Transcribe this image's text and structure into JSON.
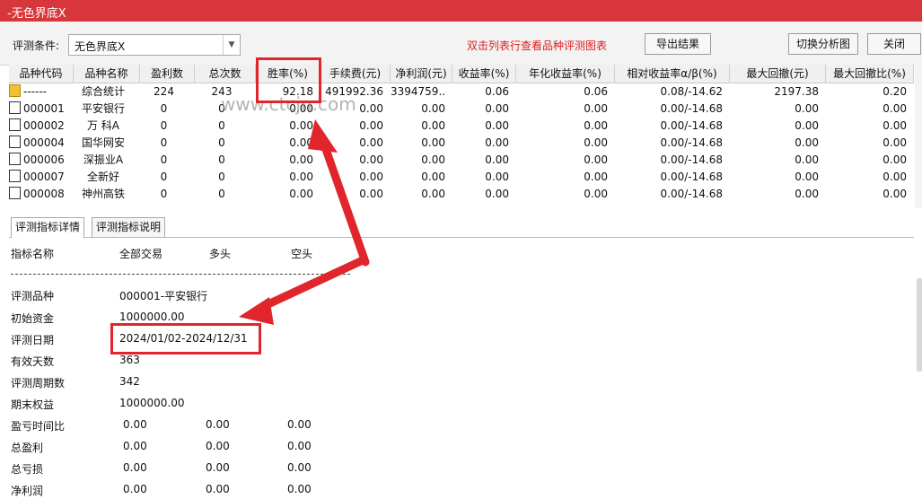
{
  "window": {
    "title": "-无色界底X"
  },
  "toolbar": {
    "condition_label": "评测条件:",
    "condition_value": "无色界底X",
    "hint": "双击列表行查看品种评测图表",
    "export_label": "导出结果",
    "switch_label": "切换分析图",
    "close_label": "关闭"
  },
  "grid": {
    "columns": [
      "品种代码",
      "品种名称",
      "盈利数",
      "总次数",
      "胜率(%)",
      "手续费(元)",
      "净利润(元)",
      "收益率(%)",
      "年化收益率(%)",
      "相对收益率α/β(%)",
      "最大回撤(元)",
      "最大回撤比(%)"
    ],
    "rows": [
      [
        "------",
        "综合统计",
        "224",
        "243",
        "92.18",
        "491992.36",
        "3394759....",
        "0.06",
        "0.06",
        "0.08/-14.62",
        "2197.38",
        "0.20"
      ],
      [
        "000001",
        "平安银行",
        "0",
        "0",
        "0.00",
        "0.00",
        "0.00",
        "0.00",
        "0.00",
        "0.00/-14.68",
        "0.00",
        "0.00"
      ],
      [
        "000002",
        "万 科A",
        "0",
        "0",
        "0.00",
        "0.00",
        "0.00",
        "0.00",
        "0.00",
        "0.00/-14.68",
        "0.00",
        "0.00"
      ],
      [
        "000004",
        "国华网安",
        "0",
        "0",
        "0.00",
        "0.00",
        "0.00",
        "0.00",
        "0.00",
        "0.00/-14.68",
        "0.00",
        "0.00"
      ],
      [
        "000006",
        "深振业A",
        "0",
        "0",
        "0.00",
        "0.00",
        "0.00",
        "0.00",
        "0.00",
        "0.00/-14.68",
        "0.00",
        "0.00"
      ],
      [
        "000007",
        "全新好",
        "0",
        "0",
        "0.00",
        "0.00",
        "0.00",
        "0.00",
        "0.00",
        "0.00/-14.68",
        "0.00",
        "0.00"
      ],
      [
        "000008",
        "神州高铁",
        "0",
        "0",
        "0.00",
        "0.00",
        "0.00",
        "0.00",
        "0.00",
        "0.00/-14.68",
        "0.00",
        "0.00"
      ]
    ]
  },
  "watermark": "www.ctcjn.com",
  "tabs": {
    "detail": "评测指标详情",
    "explain": "评测指标说明"
  },
  "detail": {
    "header": {
      "name": "指标名称",
      "all": "全部交易",
      "long": "多头",
      "short": "空头"
    },
    "items": [
      {
        "label": "评测品种",
        "all": "000001-平安银行",
        "long": "",
        "short": ""
      },
      {
        "label": "初始资金",
        "all": "1000000.00",
        "long": "",
        "short": ""
      },
      {
        "label": "评测日期",
        "all": "2024/01/02-2024/12/31",
        "long": "",
        "short": ""
      },
      {
        "label": "有效天数",
        "all": "363",
        "long": "",
        "short": ""
      },
      {
        "label": "评测周期数",
        "all": "342",
        "long": "",
        "short": ""
      },
      {
        "label": "期末权益",
        "all": "1000000.00",
        "long": "",
        "short": ""
      },
      {
        "label": "盈亏时间比",
        "all": "0.00",
        "long": "0.00",
        "short": "0.00"
      },
      {
        "label": "总盈利",
        "all": "0.00",
        "long": "0.00",
        "short": "0.00"
      },
      {
        "label": "总亏损",
        "all": "0.00",
        "long": "0.00",
        "short": "0.00"
      },
      {
        "label": "净利润",
        "all": "0.00",
        "long": "0.00",
        "short": "0.00"
      }
    ]
  },
  "colors": {
    "titlebar": "#d7363b",
    "hint": "#e01d1d",
    "annotation": "#e0262c"
  }
}
